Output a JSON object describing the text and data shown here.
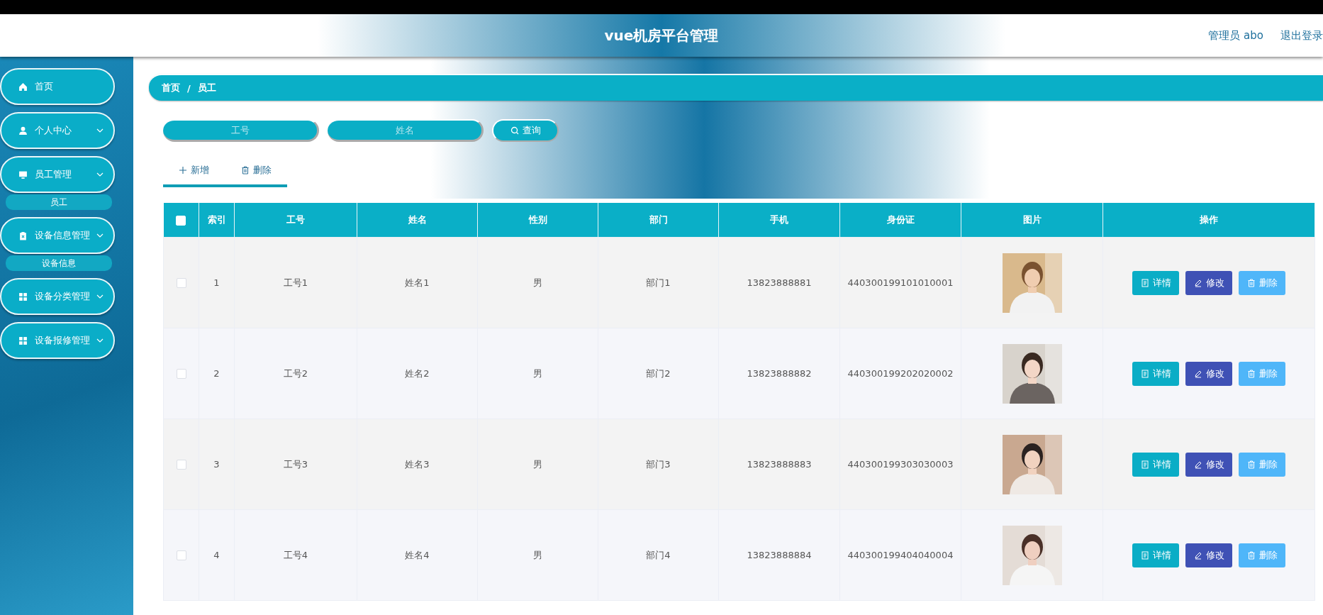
{
  "header": {
    "title": "vue机房平台管理",
    "user": "管理员 abo",
    "logout": "退出登录"
  },
  "sidebar": {
    "items": [
      {
        "label": "首页",
        "kind": "home"
      },
      {
        "label": "个人中心",
        "kind": "user"
      },
      {
        "label": "员工管理",
        "kind": "monitor",
        "children": [
          {
            "label": "员工"
          }
        ]
      },
      {
        "label": "设备信息管理",
        "kind": "clipboard",
        "children": [
          {
            "label": "设备信息"
          }
        ]
      },
      {
        "label": "设备分类管理",
        "kind": "grid"
      },
      {
        "label": "设备报修管理",
        "kind": "grid"
      }
    ]
  },
  "breadcrumb": {
    "items": [
      "首页",
      "员工"
    ],
    "separator": "/"
  },
  "search": {
    "fields": [
      {
        "placeholder": "工号"
      },
      {
        "placeholder": "姓名"
      }
    ],
    "button": "查询"
  },
  "toolbar": [
    {
      "kind": "add",
      "label": "新增"
    },
    {
      "kind": "delete",
      "label": "删除"
    }
  ],
  "table": {
    "header_checked": false,
    "columns": [
      "索引",
      "工号",
      "姓名",
      "性别",
      "部门",
      "手机",
      "身份证",
      "图片",
      "操作"
    ],
    "rows": [
      {
        "checked": false,
        "cells": [
          "1",
          "工号1",
          "姓名1",
          "男",
          "部门1",
          "13823888881",
          "440300199101010001"
        ],
        "photo": {
          "kind": "picture"
        },
        "actions": [
          {
            "kind": "detail",
            "label": "详情"
          },
          {
            "kind": "edit",
            "label": "修改"
          },
          {
            "kind": "delete",
            "label": "删除"
          }
        ]
      },
      {
        "checked": false,
        "cells": [
          "2",
          "工号2",
          "姓名2",
          "男",
          "部门2",
          "13823888882",
          "440300199202020002"
        ],
        "photo": {
          "kind": "picture"
        },
        "actions": [
          {
            "kind": "detail",
            "label": "详情"
          },
          {
            "kind": "edit",
            "label": "修改"
          },
          {
            "kind": "delete",
            "label": "删除"
          }
        ]
      },
      {
        "checked": false,
        "cells": [
          "3",
          "工号3",
          "姓名3",
          "男",
          "部门3",
          "13823888883",
          "440300199303030003"
        ],
        "photo": {
          "kind": "picture"
        },
        "actions": [
          {
            "kind": "detail",
            "label": "详情"
          },
          {
            "kind": "edit",
            "label": "修改"
          },
          {
            "kind": "delete",
            "label": "删除"
          }
        ]
      },
      {
        "checked": false,
        "cells": [
          "4",
          "工号4",
          "姓名4",
          "男",
          "部门4",
          "13823888884",
          "440300199404040004"
        ],
        "photo": {
          "kind": "picture"
        },
        "actions": [
          {
            "kind": "detail",
            "label": "详情"
          },
          {
            "kind": "edit",
            "label": "修改"
          },
          {
            "kind": "delete",
            "label": "删除"
          }
        ]
      }
    ]
  }
}
